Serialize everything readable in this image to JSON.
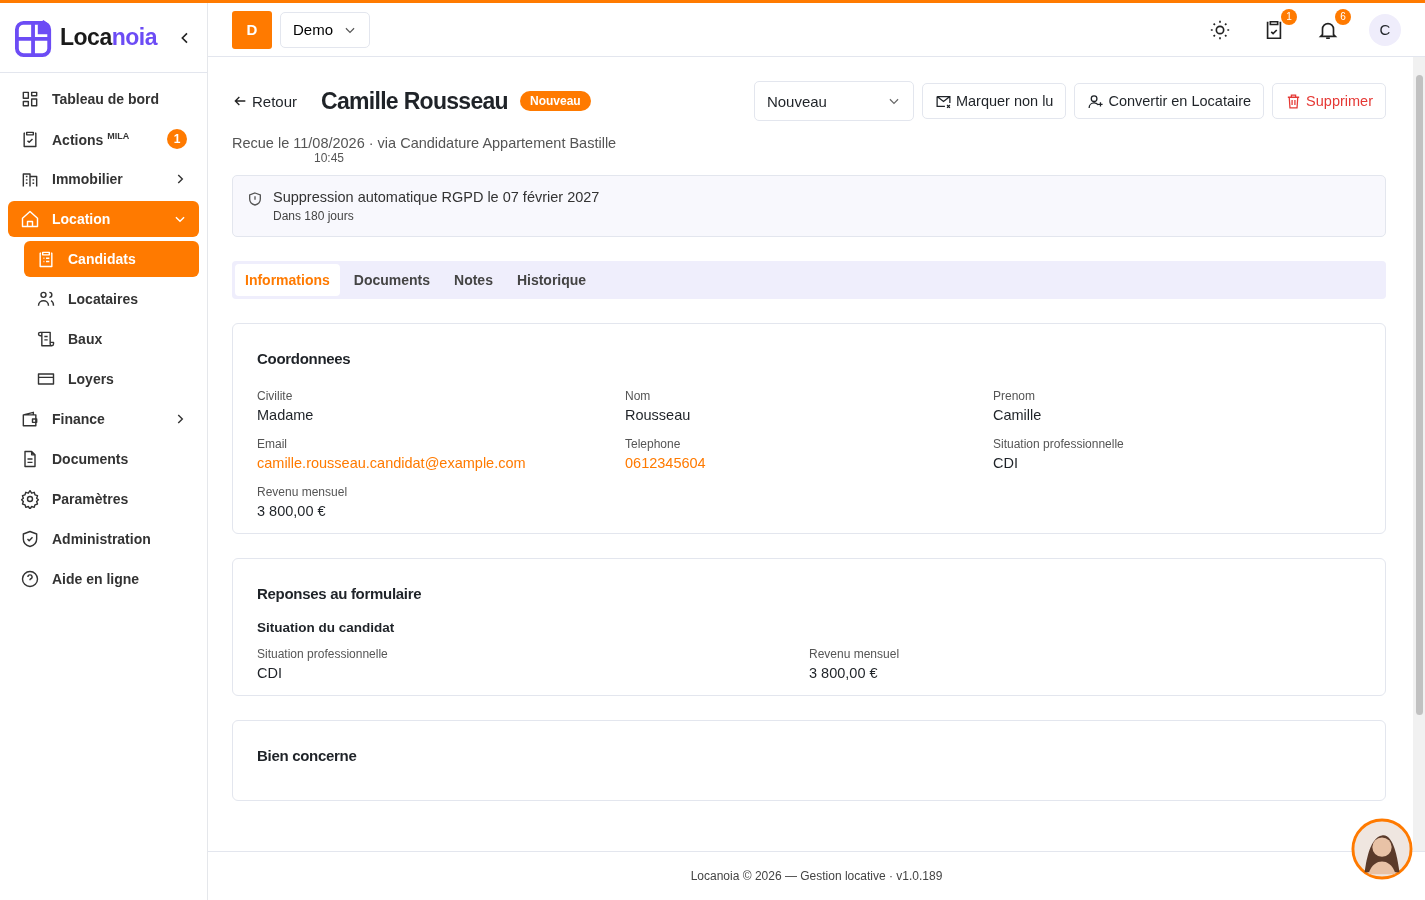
{
  "sidebar": {
    "logo": {
      "part1": "Loca",
      "part2": "noia"
    },
    "items": [
      {
        "label": "Tableau de bord",
        "selected": false
      },
      {
        "label": "Actions $^{MILA}$",
        "selected": false,
        "badge": "1"
      },
      {
        "label": "Immobilier",
        "selected": false,
        "expanded": false
      },
      {
        "label": "Location",
        "selected": true,
        "expanded": true,
        "children": [
          {
            "label": "Candidats",
            "selected": true
          },
          {
            "label": "Locataires",
            "selected": false
          },
          {
            "label": "Baux",
            "selected": false
          },
          {
            "label": "Loyers",
            "selected": false
          }
        ]
      },
      {
        "label": "Finance",
        "selected": false,
        "expanded": false
      },
      {
        "label": "Documents",
        "selected": false
      },
      {
        "label": "Paramètres",
        "selected": false
      },
      {
        "label": "Administration",
        "selected": false
      },
      {
        "label": "Aide en ligne",
        "selected": false
      }
    ]
  },
  "header": {
    "workspace_initial": "D",
    "workspace": "Demo",
    "tasks_badge": "1",
    "notifications_badge": "6",
    "user_initial": "C"
  },
  "page": {
    "back": "Retour",
    "title": "Camille Rousseau",
    "status_badge": "Nouveau",
    "status_select": "Nouveau",
    "actions": [
      {
        "label": "Marquer non lu",
        "kind": "mail"
      },
      {
        "label": "Convertir en Locataire",
        "kind": "convert"
      },
      {
        "label": "Supprimer",
        "kind": "danger"
      }
    ],
    "received_label": "Recue le",
    "received_date": "11/08/2026",
    "received_time": "10:45",
    "source": "· via Candidature Appartement Bastille",
    "notice": {
      "title": "Suppression automatique RGPD le 07 février 2027",
      "subtitle": "Dans 180 jours"
    },
    "tabs": [
      {
        "label": "Informations",
        "selected": true
      },
      {
        "label": "Documents",
        "selected": false
      },
      {
        "label": "Notes",
        "selected": false
      },
      {
        "label": "Historique",
        "selected": false
      }
    ],
    "sections": [
      {
        "title": "Coordonnees",
        "groups": [
          {
            "fields": [
              {
                "label": "Civilite",
                "value": "Madame",
                "kind": "text"
              },
              {
                "label": "Nom",
                "value": "Rousseau",
                "kind": "text"
              },
              {
                "label": "Prenom",
                "value": "Camille",
                "kind": "text"
              },
              {
                "label": "Email",
                "value": "camille.rousseau.candidat@example.com",
                "kind": "link"
              },
              {
                "label": "Telephone",
                "value": "0612345604",
                "kind": "link"
              },
              {
                "label": "Situation professionnelle",
                "value": "CDI",
                "kind": "text"
              },
              {
                "label": "Revenu mensuel",
                "value": "3 800,00 €",
                "kind": "text"
              }
            ]
          }
        ]
      },
      {
        "title": "Reponses au formulaire",
        "groups": [
          {
            "subtitle": "Situation du candidat",
            "fields": [
              {
                "label": "Situation professionnelle",
                "value": "CDI",
                "kind": "text"
              },
              {
                "label": "Revenu mensuel",
                "value": "3 800,00 €",
                "kind": "text"
              }
            ]
          }
        ]
      },
      {
        "title": "Bien concerne"
      }
    ]
  },
  "footer": "Locanoia © 2026 — Gestion locative · v1.0.189"
}
